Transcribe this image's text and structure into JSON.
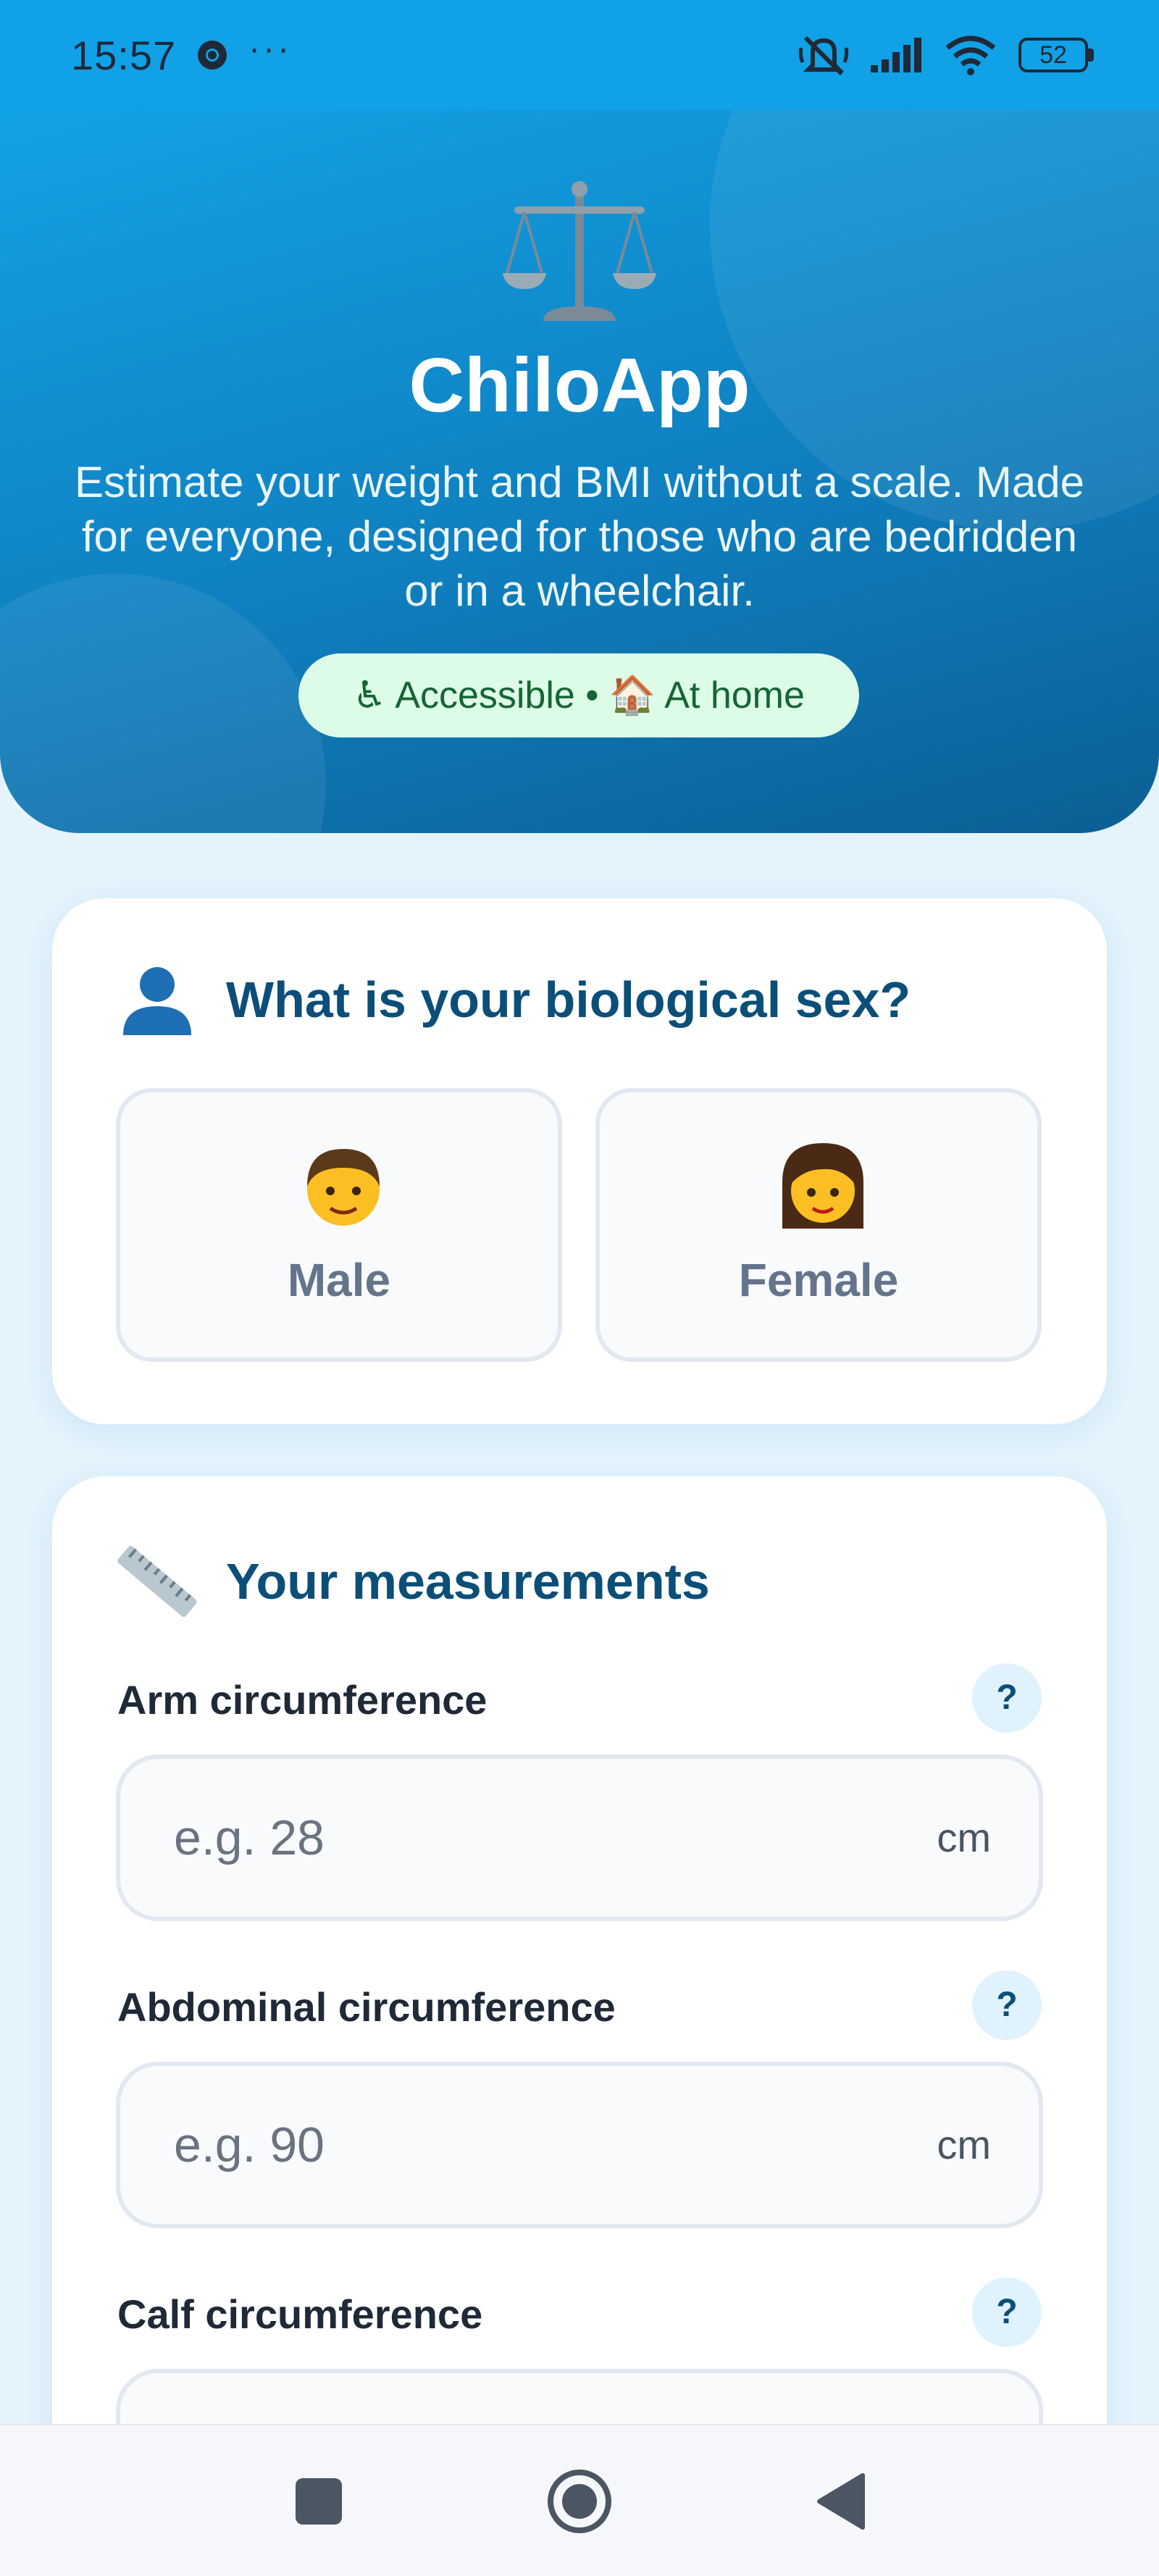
{
  "status_bar": {
    "time": "15:57",
    "more_indicator": "···",
    "battery": "52",
    "icons": [
      "chrome-icon",
      "silent-icon",
      "signal-icon",
      "wifi-icon",
      "battery-icon"
    ]
  },
  "hero": {
    "logo_icon": "balance-scale-icon",
    "title": "ChiloApp",
    "subtitle": "Estimate your weight and BMI without a scale. Made for everyone, designed for those who are bedridden or in a wheelchair.",
    "badge": "♿ Accessible • 🏠 At home"
  },
  "sex_card": {
    "icon": "person-silhouette-icon",
    "title": "What is your biological sex?",
    "options": [
      {
        "label": "Male",
        "icon": "man-face-icon"
      },
      {
        "label": "Female",
        "icon": "woman-face-icon"
      }
    ]
  },
  "measure_card": {
    "icon": "ruler-icon",
    "title": "Your measurements",
    "help_label": "?",
    "fields": [
      {
        "label": "Arm circumference",
        "placeholder": "e.g. 28",
        "unit": "cm"
      },
      {
        "label": "Abdominal circumference",
        "placeholder": "e.g. 90",
        "unit": "cm"
      },
      {
        "label": "Calf circumference",
        "placeholder": "",
        "unit": ""
      }
    ]
  },
  "nav_bar": {
    "buttons": [
      "recents-square-icon",
      "home-circle-icon",
      "back-triangle-icon"
    ]
  },
  "colors": {
    "status_bar": "#10a1e6",
    "hero_start": "#12a3e6",
    "hero_end": "#0b5f93",
    "heading": "#0b4f79",
    "badge_bg": "#dcfce7",
    "badge_text": "#166534"
  }
}
